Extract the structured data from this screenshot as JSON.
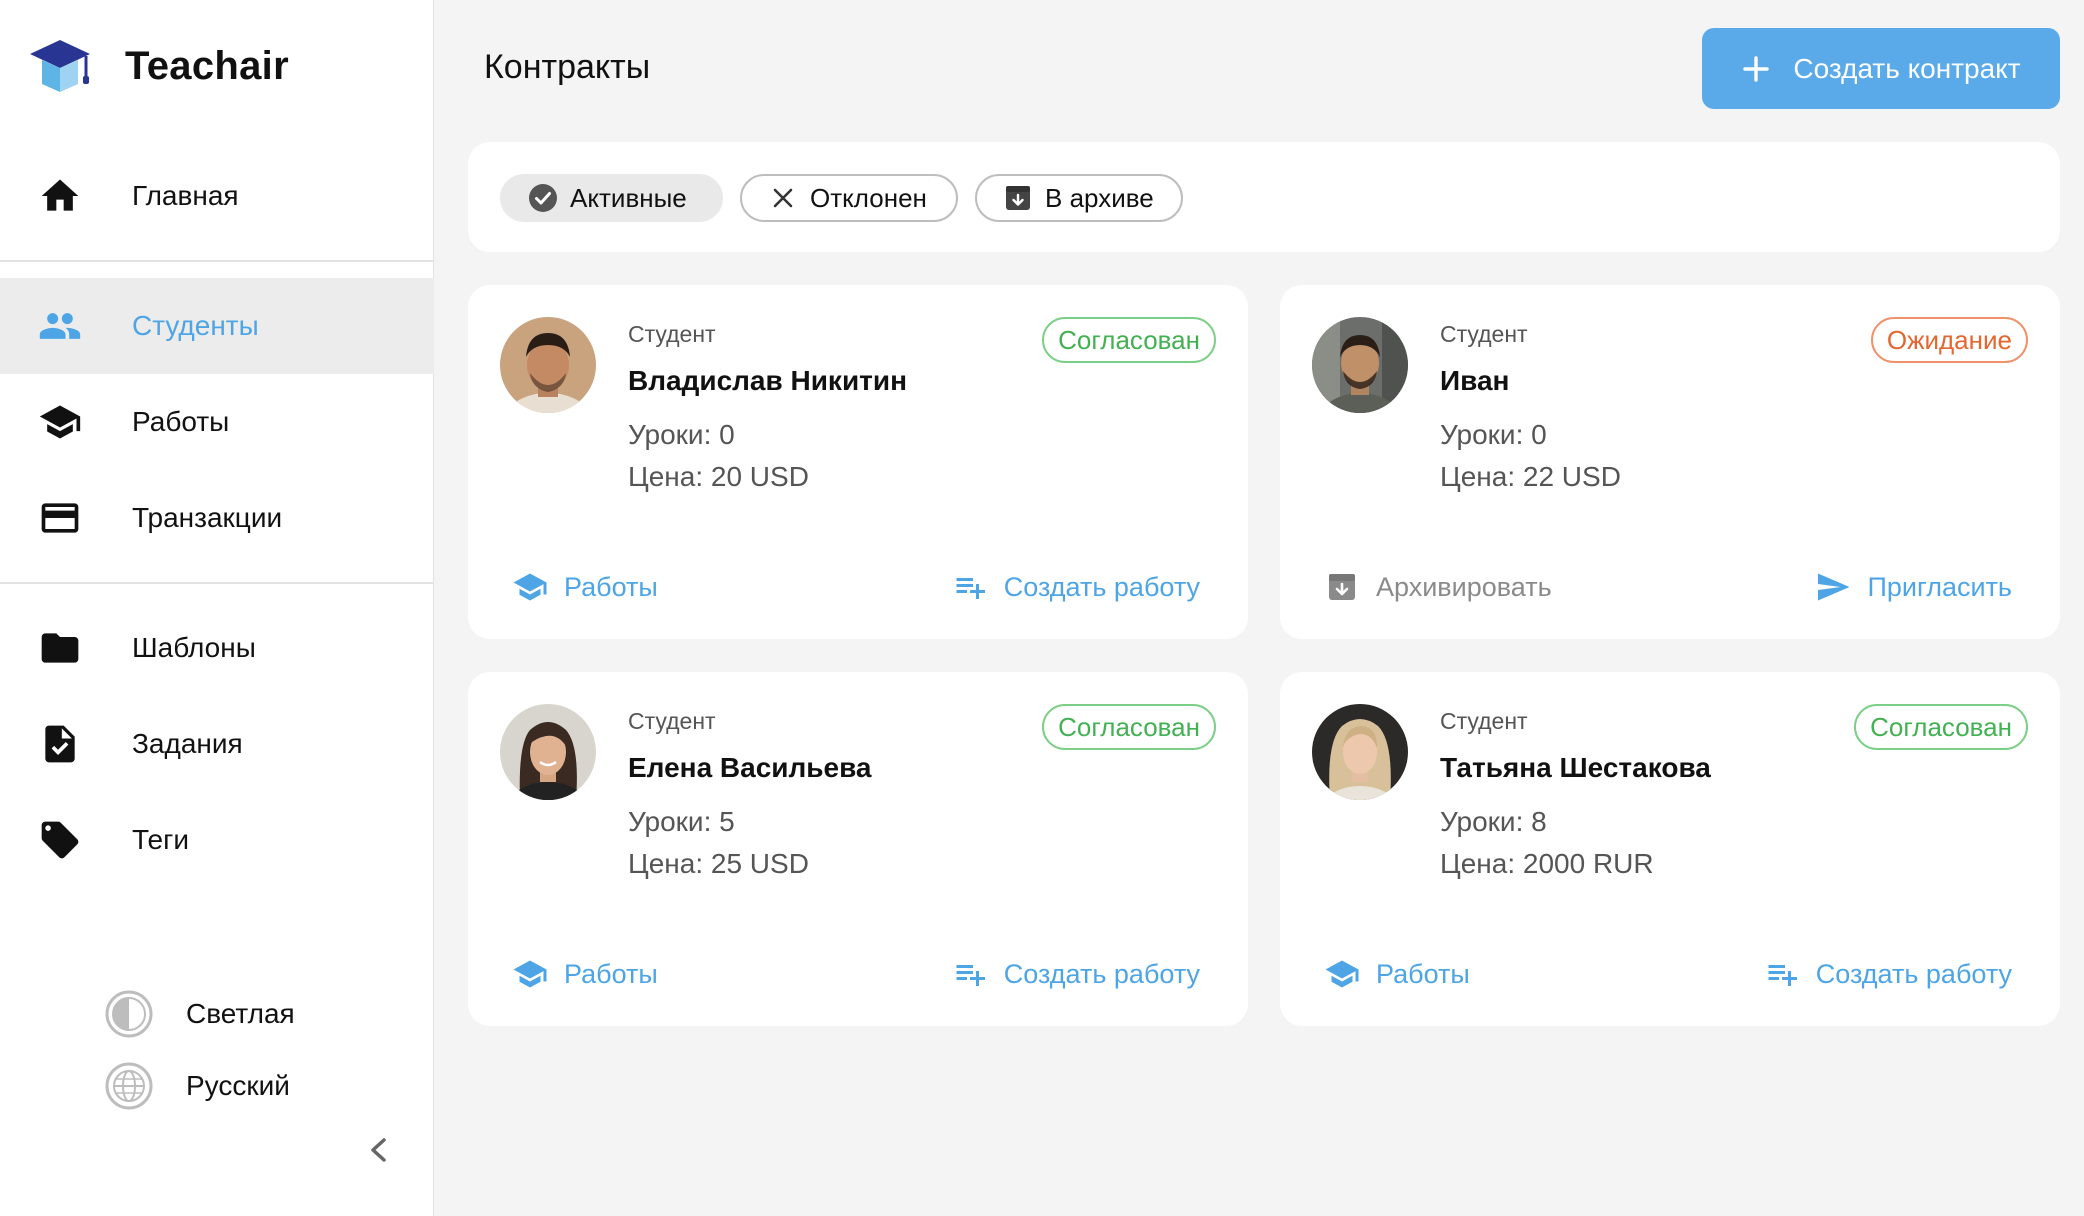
{
  "app": {
    "name": "Teachair"
  },
  "sidebar": {
    "nav": [
      {
        "label": "Главная",
        "icon": "home-icon"
      },
      {
        "label": "Студенты",
        "icon": "students-icon",
        "active": true
      },
      {
        "label": "Работы",
        "icon": "graduation-cap-icon"
      },
      {
        "label": "Транзакции",
        "icon": "credit-card-icon"
      },
      {
        "label": "Шаблоны",
        "icon": "folder-icon"
      },
      {
        "label": "Задания",
        "icon": "task-document-icon"
      },
      {
        "label": "Теги",
        "icon": "tag-icon"
      }
    ],
    "theme_label": "Светлая",
    "language_label": "Русский"
  },
  "header": {
    "title": "Контракты",
    "create_button": "Создать контракт"
  },
  "filters": [
    {
      "label": "Активные",
      "icon": "check-circle-icon",
      "selected": true
    },
    {
      "label": "Отклонен",
      "icon": "close-icon",
      "selected": false
    },
    {
      "label": "В архиве",
      "icon": "archive-icon",
      "selected": false
    }
  ],
  "contracts": [
    {
      "role": "Студент",
      "name": "Владислав Никитин",
      "lessons": "Уроки: 0",
      "price": "Цена: 20 USD",
      "status": "Согласован",
      "left_action": "Работы",
      "right_action": "Создать работу"
    },
    {
      "role": "Студент",
      "name": "Иван",
      "lessons": "Уроки: 0",
      "price": "Цена: 22 USD",
      "status": "Ожидание",
      "left_action": "Архивировать",
      "right_action": "Пригласить"
    },
    {
      "role": "Студент",
      "name": "Елена Васильева",
      "lessons": "Уроки: 5",
      "price": "Цена: 25 USD",
      "status": "Согласован",
      "left_action": "Работы",
      "right_action": "Создать работу"
    },
    {
      "role": "Студент",
      "name": "Татьяна Шестакова",
      "lessons": "Уроки: 8",
      "price": "Цена: 2000 RUR",
      "status": "Согласован",
      "left_action": "Работы",
      "right_action": "Создать работу"
    }
  ],
  "colors": {
    "accent": "#4ea5e6",
    "button": "#5aaaea",
    "status_agreed": "#43b153",
    "status_pending": "#e5662f"
  }
}
